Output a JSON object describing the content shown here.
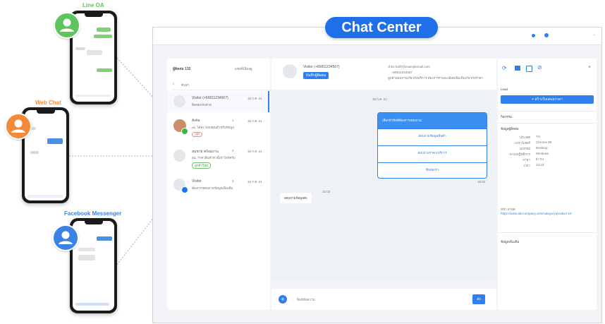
{
  "channels": {
    "line": {
      "label": "Line OA",
      "color": "#5ec45e"
    },
    "web": {
      "label": "Web Chat",
      "color": "#f28a3a"
    },
    "facebook": {
      "label": "Facebook Messenger",
      "color": "#3b82e6"
    }
  },
  "header": {
    "title": "Chat Center"
  },
  "conversation_list": {
    "title": "ผู้ติดต่อ 132",
    "filter_label": "แชทที่เปิดอยู่",
    "search_placeholder": "ค้นหา",
    "items": [
      {
        "name": "Visitor (+66811234567)",
        "time": "16 ก.ค. 21",
        "preview": "ติดต่อกลับด้วย",
        "unread": ""
      },
      {
        "name": "Anita",
        "time": "16 ก.ค. 21",
        "preview": "ok, ได้ค่ะ ขอบคุณสำหรับข้อมูล",
        "unread": "1",
        "tag": "VIP"
      },
      {
        "name": "สมชาย พร้อมงาน",
        "time": "16 ก.ค. 21",
        "preview": "สน. ราคาสินค้าตัวนี้เท่าไหร่ครับ",
        "unread": "2",
        "tag": "ลูกค้าใหม่"
      },
      {
        "name": "Visitor",
        "time": "16 ก.ค. 21",
        "preview": "ต้องการสอบถามข้อมูลเพิ่มเติม",
        "unread": "3"
      }
    ]
  },
  "chat": {
    "contact_name": "Visitor (+66811234567)",
    "save_contact_label": "บันทึกผู้ติดต่อ",
    "email": "chris.hall7@examplemail.com",
    "phone": "+66811234567",
    "note": "ลูกค้าสอบถามเกี่ยวกับบริการ ต้องการรายละเอียดเพิ่มเติมเกี่ยวกับราคา",
    "date_chip": "16 ก.ค. 21",
    "card_title": "เลือกหัวข้อที่ต้องการสอบถาม",
    "card_options": [
      "สอบถามข้อมูลสินค้า",
      "สอบถามราคา/บริการ",
      "ติดต่อเรา"
    ],
    "card_time": "15:02",
    "incoming_message": "สอบถามข้อมูลค่ะ",
    "incoming_time": "15:03",
    "input_placeholder": "พิมพ์ข้อความ",
    "send_label": "ส่ง"
  },
  "side_panel": {
    "lead_label": "Lead",
    "create_button": "+ สร้างใบเสนอราคา",
    "section_activities": "กิจกรรม",
    "section_info": "ข้อมูลผู้ติดต่อ",
    "info_rows": [
      {
        "label": "ประเทศ",
        "value": "TH"
      },
      {
        "label": "เบราว์เซอร์",
        "value": "Chrome 90"
      },
      {
        "label": "อุปกรณ์",
        "value": "Desktop"
      },
      {
        "label": "ระบบปฏิบัติการ",
        "value": "Windows"
      },
      {
        "label": "ภาษา",
        "value": "th-TH"
      },
      {
        "label": "เวลา",
        "value": "13:10"
      }
    ],
    "visited_label": "หน้า ล่าสุด",
    "visited_url": "https://www.abccompany.com/category/product-10",
    "section_tags": "ข้อมูลเพิ่มเติม"
  },
  "colors": {
    "accent": "#2f80ed",
    "header_pill": "#1e6fe8"
  }
}
